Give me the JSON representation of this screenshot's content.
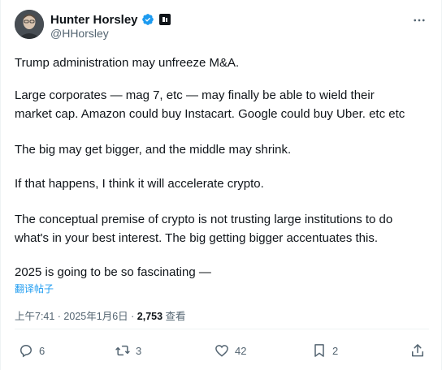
{
  "author": {
    "name": "Hunter Horsley",
    "handle": "@HHorsley"
  },
  "tweet": {
    "paragraphs": [
      "Trump administration may unfreeze M&A.",
      "Large corporates — mag 7, etc — may finally be able to wield their",
      "market cap. Amazon could buy Instacart. Google could buy Uber. etc etc",
      "The big may get bigger, and the middle may shrink.",
      "If that happens, I think it will accelerate crypto.",
      "The conceptual premise of crypto is not trusting large institutions to do",
      "what's in your best interest. The big getting bigger accentuates this.",
      "2025 is going to be so fascinating —"
    ],
    "translate_label": "翻译帖子"
  },
  "meta": {
    "time": "上午7:41 · 2025年1月6日 · ",
    "views_count": "2,753",
    "views_label": " 查看"
  },
  "actions": {
    "replies": "6",
    "reposts": "3",
    "likes": "42",
    "bookmarks": "2"
  },
  "colors": {
    "accent": "#1d9bf0",
    "text": "#0f1419",
    "secondary": "#536471"
  }
}
